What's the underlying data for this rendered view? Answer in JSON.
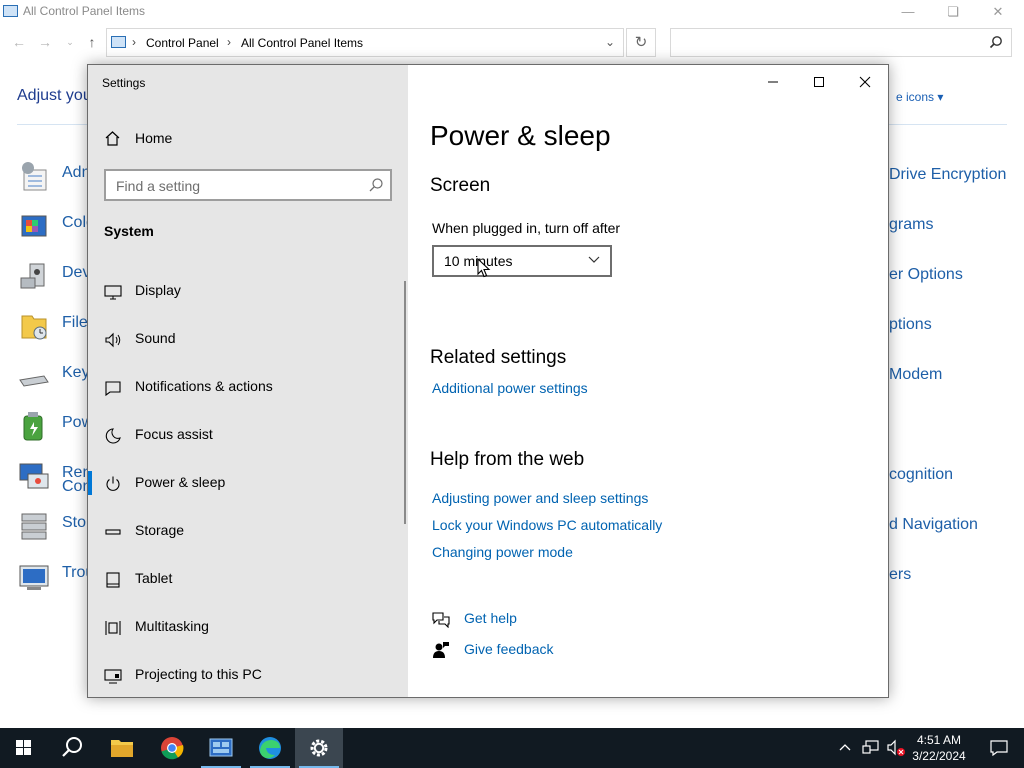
{
  "control_panel": {
    "title": "All Control Panel Items",
    "breadcrumb": [
      "Control Panel",
      "All Control Panel Items"
    ],
    "heading_partial": "Adjust you",
    "view_by_partial": "e icons",
    "items_left": [
      "Adm",
      "Colo",
      "Devi",
      "File",
      "Key",
      "Pow",
      "Ren",
      "Con",
      "Stor",
      "Trou"
    ],
    "items_right": [
      "Drive Encryption",
      "grams",
      "er Options",
      "ptions",
      "Modem",
      "cognition",
      "d Navigation",
      "ers"
    ]
  },
  "settings": {
    "window_title": "Settings",
    "nav": {
      "home": "Home",
      "search_placeholder": "Find a setting",
      "section": "System",
      "items": [
        {
          "label": "Display",
          "icon": "display-icon"
        },
        {
          "label": "Sound",
          "icon": "sound-icon"
        },
        {
          "label": "Notifications & actions",
          "icon": "notifications-icon"
        },
        {
          "label": "Focus assist",
          "icon": "focus-assist-icon"
        },
        {
          "label": "Power & sleep",
          "icon": "power-icon",
          "active": true
        },
        {
          "label": "Storage",
          "icon": "storage-icon"
        },
        {
          "label": "Tablet",
          "icon": "tablet-icon"
        },
        {
          "label": "Multitasking",
          "icon": "multitasking-icon"
        },
        {
          "label": "Projecting to this PC",
          "icon": "projecting-icon"
        }
      ]
    },
    "content": {
      "title": "Power & sleep",
      "screen_heading": "Screen",
      "plugged_label": "When plugged in, turn off after",
      "plugged_value": "10 minutes",
      "related_heading": "Related settings",
      "related_link": "Additional power settings",
      "help_heading": "Help from the web",
      "help_links": [
        "Adjusting power and sleep settings",
        "Lock your Windows PC automatically",
        "Changing power mode"
      ],
      "get_help": "Get help",
      "give_feedback": "Give feedback"
    },
    "accent_color": "#0078d7"
  },
  "taskbar": {
    "time": "4:51 AM",
    "date": "3/22/2024",
    "apps": [
      "start-icon",
      "search-icon",
      "file-explorer-icon",
      "chrome-icon",
      "control-panel-icon",
      "edge-icon",
      "settings-gear-icon"
    ]
  }
}
